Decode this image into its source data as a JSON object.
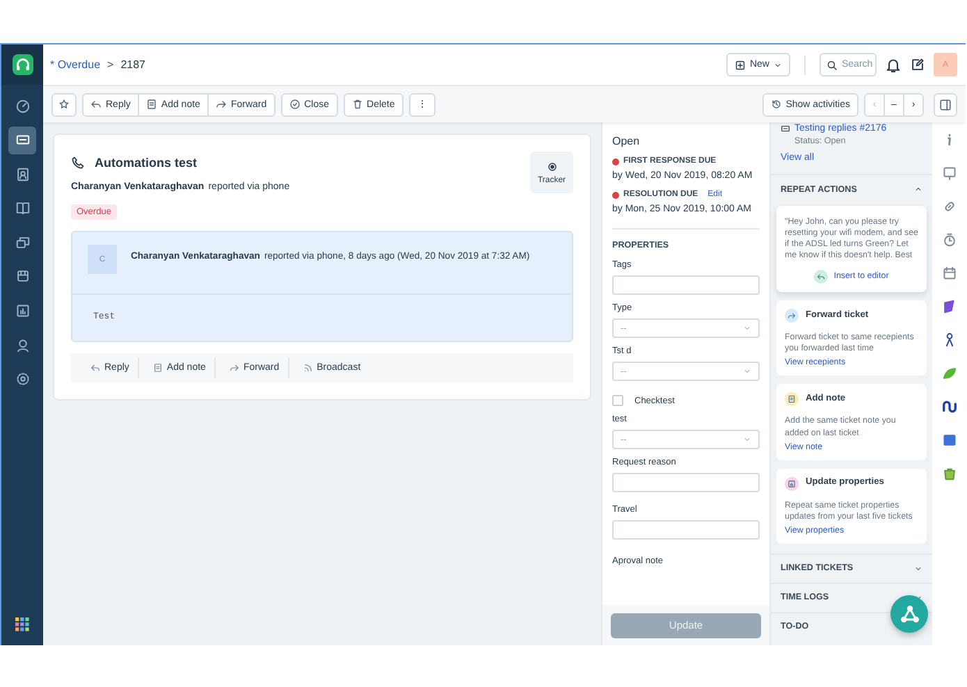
{
  "sidebar": {
    "nav": [
      {
        "kind": "dashboard",
        "selected": false
      },
      {
        "kind": "tickets",
        "selected": true
      },
      {
        "kind": "contacts",
        "selected": false
      },
      {
        "kind": "solutions",
        "selected": false
      },
      {
        "kind": "forums",
        "selected": false
      },
      {
        "kind": "phone",
        "selected": false
      },
      {
        "kind": "reports",
        "selected": false
      },
      {
        "kind": "social",
        "selected": false
      },
      {
        "kind": "admin",
        "selected": false
      }
    ]
  },
  "header": {
    "breadcrumb_link": "* Overdue",
    "separator": ">",
    "ticket_number": "2187",
    "new_button": "New",
    "search": {
      "placeholder": "Search"
    },
    "avatar": "A"
  },
  "toolbar": {
    "buttons": [
      {
        "kind": "star"
      },
      {
        "kind": "reply",
        "label": "Reply"
      },
      {
        "kind": "note",
        "label": "Add note"
      },
      {
        "kind": "forward",
        "label": "Forward"
      },
      {
        "kind": "close",
        "label": "Close"
      },
      {
        "kind": "delete",
        "label": "Delete"
      },
      {
        "kind": "more",
        "label": "⋮"
      }
    ],
    "show_activities": "Show activities",
    "pager": [
      "‹",
      "–",
      "›"
    ]
  },
  "ticket": {
    "subject": "Automations test",
    "requester": "Charanyan Venkataraghavan",
    "source": "reported via phone",
    "tag": "Overdue",
    "tracker": "Tracker",
    "message": {
      "avatar": "C",
      "author": "Charanyan Venkataraghavan",
      "meta": "reported via phone, 8 days ago (Wed, 20 Nov 2019 at 7:32 AM)",
      "body": "Test"
    },
    "actions": [
      {
        "kind": "reply",
        "label": "Reply"
      },
      {
        "kind": "note",
        "label": "Add note"
      },
      {
        "kind": "forward",
        "label": "Forward"
      },
      {
        "kind": "broadcast",
        "label": "Broadcast"
      }
    ]
  },
  "properties": {
    "status": "Open",
    "due": [
      {
        "label": "FIRST RESPONSE DUE",
        "date": "by Wed, 20 Nov 2019, 08:20 AM"
      },
      {
        "label": "RESOLUTION DUE",
        "edit": "Edit",
        "date": "by Mon, 25 Nov 2019, 10:00 AM"
      }
    ],
    "title": "PROPERTIES",
    "fields": [
      {
        "kind": "text",
        "label": "Tags"
      },
      {
        "kind": "select",
        "label": "Type",
        "value": "--"
      },
      {
        "kind": "select",
        "label": "Tst d",
        "value": "--"
      },
      {
        "kind": "checkbox",
        "label": "Checktest",
        "checked": false
      },
      {
        "kind": "select",
        "label": "test",
        "value": "--"
      },
      {
        "kind": "text",
        "label": "Request reason"
      },
      {
        "kind": "text",
        "label": "Travel"
      },
      {
        "kind": "label",
        "label": "Aproval note"
      }
    ],
    "update_button": {
      "label": "Update",
      "disabled": true
    }
  },
  "activity": {
    "related_ticket": "Testing replies #2176",
    "related_status": "Status: Open",
    "view_all": "View all",
    "repeat_actions": {
      "title": "REPEAT ACTIONS",
      "expanded": true,
      "cards": [
        {
          "kind": "quote",
          "text": "\"Hey John, can you please try resetting your wifi modem, and see if the ADSL led turns Green? Let me know if this doesn't help. Best",
          "action": "Insert to editor",
          "color": "#c9f0e1"
        },
        {
          "kind": "action",
          "title": "Forward ticket",
          "text": "Forward ticket to same recepients you forwarded last time",
          "link": "View recepients",
          "color": "#d5ebfb"
        },
        {
          "kind": "action",
          "title": "Add note",
          "text": "Add the same ticket note you added on last ticket",
          "link": "View note",
          "color": "#fbecb8"
        },
        {
          "kind": "action",
          "title": "Update properties",
          "text": "Repeat same ticket properties updates from your last five tickets",
          "link": "View properties",
          "color": "#f8d2e5"
        }
      ]
    },
    "sections": [
      {
        "title": "LINKED TICKETS",
        "expanded": false
      },
      {
        "title": "TIME LOGS",
        "expanded": false
      },
      {
        "title": "TO-DO",
        "expanded": false
      }
    ]
  }
}
